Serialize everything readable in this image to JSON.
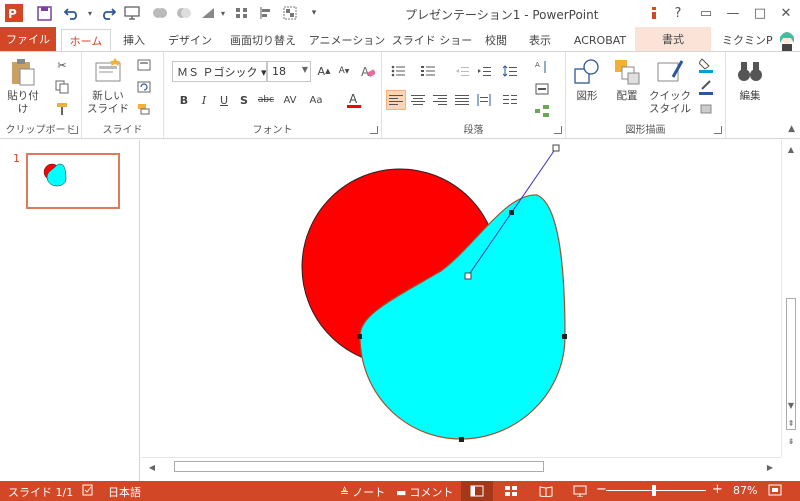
{
  "app": {
    "title": "プレゼンテーション1 - PowerPoint",
    "icon": "powerpoint-logo",
    "window_controls": {
      "help": "?",
      "restore": "▭",
      "minimize": "—",
      "maximize": "□",
      "close": "✕"
    }
  },
  "ribbon_tabs": {
    "file": "ファイル",
    "home": "ホーム",
    "insert": "挿入",
    "design": "デザイン",
    "transitions": "画面切り替え",
    "animations": "アニメーション",
    "slideshow": "スライド ショー",
    "review": "校閲",
    "view": "表示",
    "acrobat": "ACROBAT",
    "format": "書式",
    "user": "ミクミンP"
  },
  "ribbon": {
    "clipboard": {
      "paste": "貼り付け",
      "label": "クリップボード"
    },
    "slides": {
      "new_slide_line1": "新しい",
      "new_slide_line2": "スライド",
      "label": "スライド"
    },
    "font": {
      "font_name": "ＭＳ Ｐゴシック ▾",
      "font_size": "18",
      "label": "フォント"
    },
    "paragraph": {
      "label": "段落"
    },
    "drawing": {
      "shapes": "図形",
      "arrange": "配置",
      "quick_style_line1": "クイック",
      "quick_style_line2": "スタイル",
      "label": "図形描画"
    },
    "editing": {
      "edit": "編集"
    }
  },
  "thumbnails": [
    {
      "number": "1"
    }
  ],
  "status": {
    "slide": "スライド 1/1",
    "language": "日本語",
    "notes": "ノート",
    "comments": "コメント",
    "zoom": "87%",
    "zoom_out": "−",
    "zoom_in": "+"
  },
  "colors": {
    "accent": "#d24726",
    "circle_fill": "#ff0000",
    "drop_fill": "#00ffff",
    "handle_line": "#3333cc"
  }
}
